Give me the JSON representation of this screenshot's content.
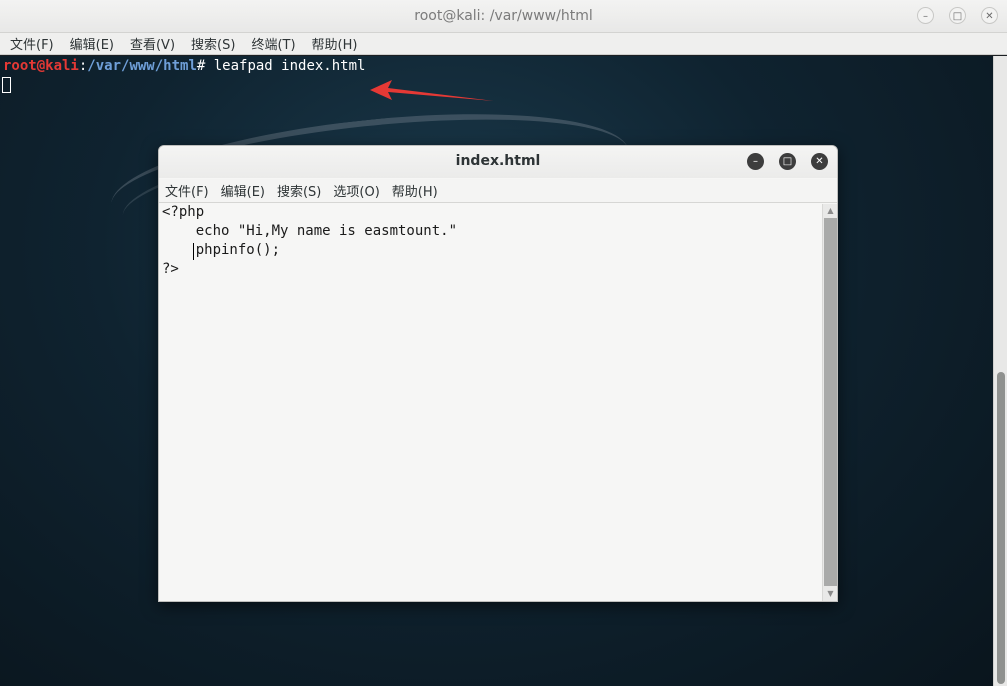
{
  "terminal": {
    "title": "root@kali: /var/www/html",
    "menu": [
      "文件(F)",
      "编辑(E)",
      "查看(V)",
      "搜索(S)",
      "终端(T)",
      "帮助(H)"
    ],
    "prompt_user": "root@kali",
    "prompt_sep": ":",
    "prompt_path": "/var/www/html",
    "prompt_symbol": "# ",
    "command": "leafpad index.html",
    "window_buttons": {
      "minimize": "–",
      "maximize": "□",
      "close": "✕"
    }
  },
  "leafpad": {
    "title": "index.html",
    "menu": [
      "文件(F)",
      "编辑(E)",
      "搜索(S)",
      "选项(O)",
      "帮助(H)"
    ],
    "lines": [
      "<?php",
      "    echo \"Hi,My name is easmtount.\"",
      "    phpinfo();",
      "?>"
    ],
    "window_buttons": {
      "minimize": "–",
      "maximize": "□",
      "close": "✕"
    }
  },
  "annotation": {
    "arrow_color": "#e53935"
  },
  "icons": [
    "minimize-icon",
    "maximize-icon",
    "close-icon",
    "scroll-up-icon",
    "scroll-down-icon"
  ]
}
